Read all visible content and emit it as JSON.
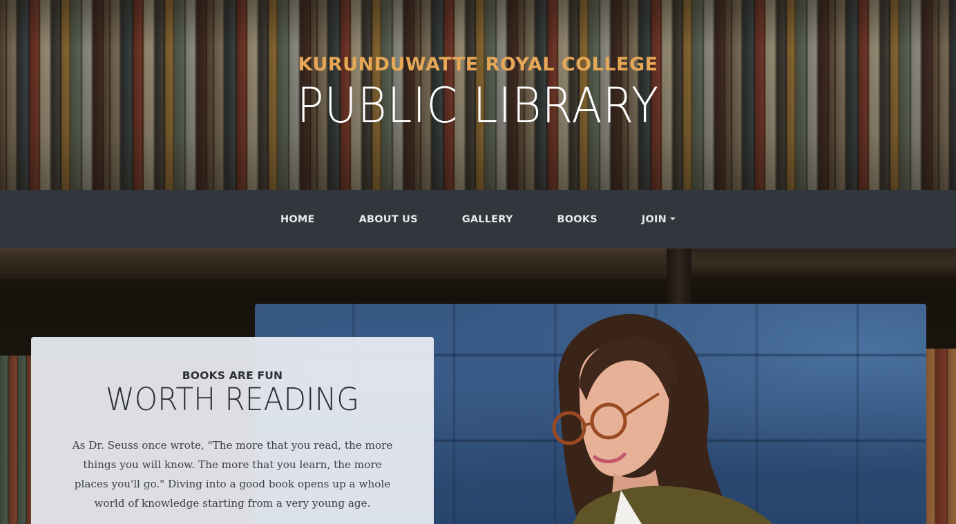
{
  "header": {
    "upper_title": "KURUNDUWATTE ROYAL COLLEGE",
    "lower_title": "PUBLIC LIBRARY"
  },
  "nav": {
    "items": [
      {
        "label": "HOME"
      },
      {
        "label": "ABOUT US"
      },
      {
        "label": "GALLERY"
      },
      {
        "label": "BOOKS"
      },
      {
        "label": "JOIN",
        "dropdown": true
      }
    ]
  },
  "intro": {
    "subheading": "BOOKS ARE FUN",
    "heading": "WORTH READING",
    "body": "As Dr. Seuss once wrote, \"The more that you read, the more things you will know. The more that you learn, the more places you'll go.\" Diving into a good book opens up a whole world of knowledge starting from a very young age."
  },
  "colors": {
    "accent": "#e6a756",
    "navbar": "#33383f",
    "card": "#ebeef3"
  }
}
